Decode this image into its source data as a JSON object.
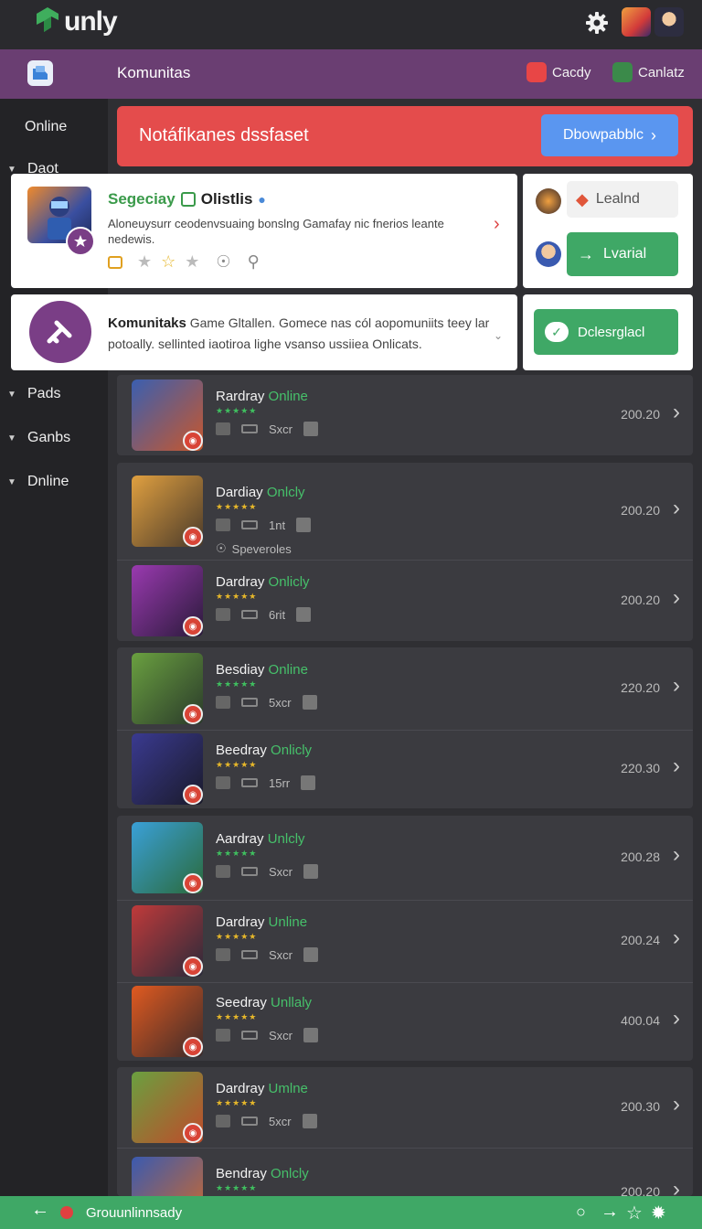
{
  "app": {
    "logo_text": "unly"
  },
  "community_bar": {
    "title": "Komunitas",
    "actions": [
      {
        "label": "Cacdy",
        "color": "#e84646"
      },
      {
        "label": "Canlatz",
        "color": "#3b8a4a"
      }
    ]
  },
  "sidebar": {
    "items": [
      {
        "label": "Online"
      },
      {
        "label": "Daot"
      },
      {
        "label": "Pads"
      },
      {
        "label": "Ganbs"
      },
      {
        "label": "Dnline"
      }
    ]
  },
  "banner": {
    "text": "Notáfikanes dssfaset",
    "button_label": "Dbowpabblc",
    "color": "#e44c4c",
    "button_color": "#5a96f0"
  },
  "featured": {
    "title_prefix": "Segeciay",
    "title_suffix": "Olistlis",
    "description": "Aloneuysurr ceodenvsuaing bonslng Gamafay nic fnerios leante nedewis."
  },
  "side_actions": {
    "lead_label": "Lealnd",
    "primary_label": "Lvarial",
    "chat_label": "Dclesrglacl"
  },
  "community_card": {
    "title": "Komunitaks",
    "text": "Game Gltallen. Gomece nas cól aopomuniits teey lar potoally. sellinted iaotiroa lighe vsanso ussiiea Onlicats."
  },
  "games": [
    {
      "title": "Rardray",
      "status": "Online",
      "stars": "★★★★★",
      "star_color": "#3fbf5f",
      "meta1": "Sxcr",
      "extra": "",
      "num": "200.20"
    },
    {
      "title": "Dardiay",
      "status": "Onlcly",
      "stars": "★★★★★",
      "star_color": "#e6b72a",
      "meta1": "1nt",
      "extra": "Speveroles",
      "num": "200.20"
    },
    {
      "title": "Dardray",
      "status": "Onlicly",
      "stars": "★★★★★",
      "star_color": "#e6b72a",
      "meta1": "6rit",
      "extra": "",
      "num": "200.20"
    },
    {
      "title": "Besdiay",
      "status": "Online",
      "stars": "★★★★★",
      "star_color": "#3fbf5f",
      "meta1": "5xcr",
      "extra": "",
      "num": "220.20"
    },
    {
      "title": "Beedray",
      "status": "Onlicly",
      "stars": "★★★★★",
      "star_color": "#e6b72a",
      "meta1": "15rr",
      "extra": "",
      "num": "220.30"
    },
    {
      "title": "Aardray",
      "status": "Unlcly",
      "stars": "★★★★★",
      "star_color": "#3fbf5f",
      "meta1": "Sxcr",
      "extra": "",
      "num": "200.28"
    },
    {
      "title": "Dardray",
      "status": "Unline",
      "stars": "★★★★★",
      "star_color": "#e6b72a",
      "meta1": "Sxcr",
      "extra": "",
      "num": "200.24"
    },
    {
      "title": "Seedray",
      "status": "Unllaly",
      "stars": "★★★★★",
      "star_color": "#e6b72a",
      "meta1": "Sxcr",
      "extra": "",
      "num": "400.04"
    },
    {
      "title": "Dardray",
      "status": "Umlne",
      "stars": "★★★★★",
      "star_color": "#e6b72a",
      "meta1": "5xcr",
      "extra": "",
      "num": "200.30"
    },
    {
      "title": "Bendray",
      "status": "Onlcly",
      "stars": "★★★★★",
      "star_color": "#3fbf5f",
      "meta1": "",
      "extra": "",
      "num": "200.20"
    }
  ],
  "bottom_bar": {
    "text": "Grouunlinnsady",
    "color": "#3fa866"
  },
  "colors": {
    "accent_green": "#46c06a",
    "community_bar": "#6a3e72",
    "background": "#2f2f33"
  }
}
